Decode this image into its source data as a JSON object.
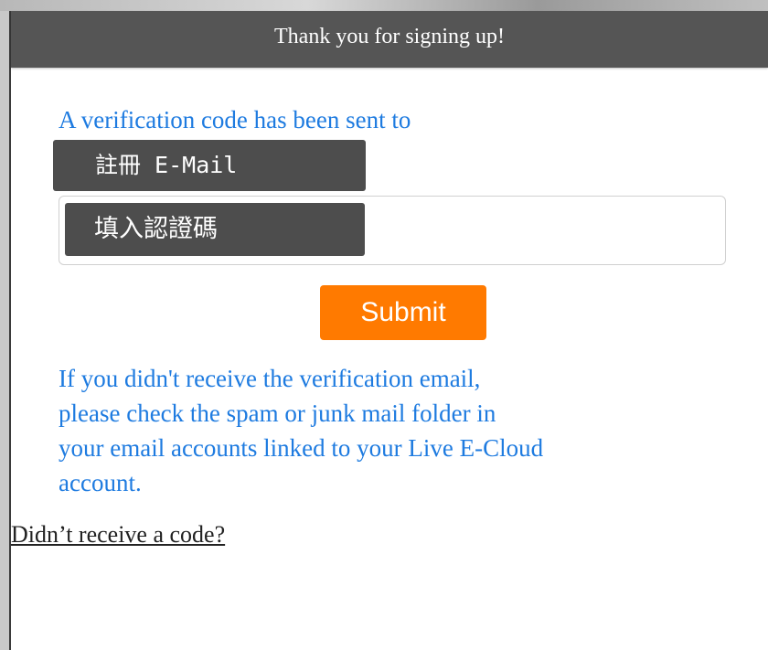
{
  "header": {
    "title": "Thank you for signing up!"
  },
  "verification": {
    "sent_text": "A verification code has been sent to",
    "email_label": "註冊 E-Mail",
    "code_label": "填入認證碼"
  },
  "submit": {
    "label": "Submit"
  },
  "help": {
    "lines": [
      "If you didn't receive the verification email,",
      "please check the spam or junk mail folder in",
      "your email accounts linked to your Live E-Cloud",
      "account."
    ]
  },
  "resend": {
    "label": "Didn’t receive a code?"
  },
  "colors": {
    "header_bg": "#555555",
    "link_blue": "#1e7be0",
    "submit_orange": "#ff7a00",
    "mask_gray": "#4d4d4d"
  }
}
